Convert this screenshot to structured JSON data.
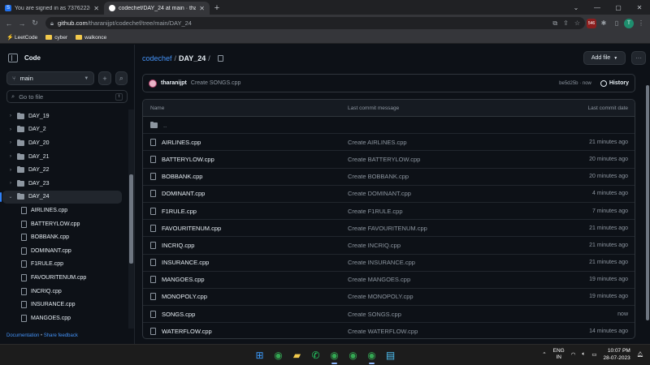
{
  "browser": {
    "tabs": [
      {
        "title": "You are signed in as 7376222cb1",
        "favicon_color": "#1f6feb",
        "favicon_letter": "S",
        "active": false
      },
      {
        "title": "codechef/DAY_24 at main · thara",
        "favicon_color": "#ffffff",
        "favicon_letter": "",
        "active": true
      }
    ],
    "url_host": "github.com",
    "url_path": "/tharanijpt/codechef/tree/main/DAY_24",
    "extension_badge": "546",
    "profile_letter": "T",
    "bookmarks": [
      {
        "label": "LeetCode",
        "icon": "leetcode-icon"
      },
      {
        "label": "cyber",
        "icon": "folder-icon"
      },
      {
        "label": "walkonce",
        "icon": "folder-icon"
      }
    ]
  },
  "sidebar": {
    "title": "Code",
    "branch": "main",
    "search_placeholder": "Go to file",
    "search_shortcut": "t",
    "tree": [
      {
        "label": "DAY_19",
        "type": "dir",
        "expanded": false
      },
      {
        "label": "DAY_2",
        "type": "dir",
        "expanded": false
      },
      {
        "label": "DAY_20",
        "type": "dir",
        "expanded": false
      },
      {
        "label": "DAY_21",
        "type": "dir",
        "expanded": false
      },
      {
        "label": "DAY_22",
        "type": "dir",
        "expanded": false
      },
      {
        "label": "DAY_23",
        "type": "dir",
        "expanded": false
      },
      {
        "label": "DAY_24",
        "type": "dir",
        "expanded": true,
        "active": true
      },
      {
        "label": "AIRLINES.cpp",
        "type": "file"
      },
      {
        "label": "BATTERYLOW.cpp",
        "type": "file"
      },
      {
        "label": "BOBBANK.cpp",
        "type": "file"
      },
      {
        "label": "DOMINANT.cpp",
        "type": "file"
      },
      {
        "label": "F1RULE.cpp",
        "type": "file"
      },
      {
        "label": "FAVOURITENUM.cpp",
        "type": "file"
      },
      {
        "label": "INCRIQ.cpp",
        "type": "file"
      },
      {
        "label": "INSURANCE.cpp",
        "type": "file"
      },
      {
        "label": "MANGOES.cpp",
        "type": "file"
      }
    ],
    "footer_docs": "Documentation",
    "footer_sep": "•",
    "footer_feedback": "Share feedback"
  },
  "main": {
    "breadcrumb_repo": "codechef",
    "breadcrumb_sep": "/",
    "breadcrumb_dir": "DAY_24",
    "breadcrumb_trail": "/",
    "add_file_label": "Add file",
    "commit": {
      "author": "tharanijpt",
      "message": "Create SONGS.cpp",
      "sha": "be5d25b",
      "sep": "·",
      "time": "now",
      "history_label": "History"
    },
    "table_headers": {
      "name": "Name",
      "message": "Last commit message",
      "date": "Last commit date"
    },
    "parent_dir": "..",
    "files": [
      {
        "name": "AIRLINES.cpp",
        "message": "Create AIRLINES.cpp",
        "date": "21 minutes ago"
      },
      {
        "name": "BATTERYLOW.cpp",
        "message": "Create BATTERYLOW.cpp",
        "date": "20 minutes ago"
      },
      {
        "name": "BOBBANK.cpp",
        "message": "Create BOBBANK.cpp",
        "date": "20 minutes ago"
      },
      {
        "name": "DOMINANT.cpp",
        "message": "Create DOMINANT.cpp",
        "date": "4 minutes ago"
      },
      {
        "name": "F1RULE.cpp",
        "message": "Create F1RULE.cpp",
        "date": "7 minutes ago"
      },
      {
        "name": "FAVOURITENUM.cpp",
        "message": "Create FAVOURITENUM.cpp",
        "date": "21 minutes ago"
      },
      {
        "name": "INCRIQ.cpp",
        "message": "Create INCRIQ.cpp",
        "date": "21 minutes ago"
      },
      {
        "name": "INSURANCE.cpp",
        "message": "Create INSURANCE.cpp",
        "date": "21 minutes ago"
      },
      {
        "name": "MANGOES.cpp",
        "message": "Create MANGOES.cpp",
        "date": "19 minutes ago"
      },
      {
        "name": "MONOPOLY.cpp",
        "message": "Create MONOPOLY.cpp",
        "date": "19 minutes ago"
      },
      {
        "name": "SONGS.cpp",
        "message": "Create SONGS.cpp",
        "date": "now"
      },
      {
        "name": "WATERFLOW.cpp",
        "message": "Create WATERFLOW.cpp",
        "date": "14 minutes ago"
      }
    ]
  },
  "taskbar": {
    "apps": [
      {
        "name": "start-button",
        "icon": "windows-icon",
        "color": "#3b9cff"
      },
      {
        "name": "chrome-app",
        "icon": "chrome-icon",
        "color": "#34a853"
      },
      {
        "name": "file-explorer-app",
        "icon": "folder-icon",
        "color": "#f2c94c"
      },
      {
        "name": "whatsapp-app",
        "icon": "whatsapp-icon",
        "color": "#25d366"
      },
      {
        "name": "chrome-profile-app-1",
        "icon": "chrome-icon",
        "color": "#34a853",
        "active": true
      },
      {
        "name": "chrome-profile-app-2",
        "icon": "chrome-icon",
        "color": "#34a853"
      },
      {
        "name": "chrome-profile-app-3",
        "icon": "chrome-icon",
        "color": "#34a853",
        "active": true
      },
      {
        "name": "notepad-app",
        "icon": "notepad-icon",
        "color": "#4fc3f7"
      }
    ],
    "lang_top": "ENG",
    "lang_bottom": "IN",
    "time": "10:07 PM",
    "date": "28-07-2023"
  },
  "colors": {
    "accent": "#4493f8",
    "background": "#0d1117",
    "border": "#30363d"
  }
}
